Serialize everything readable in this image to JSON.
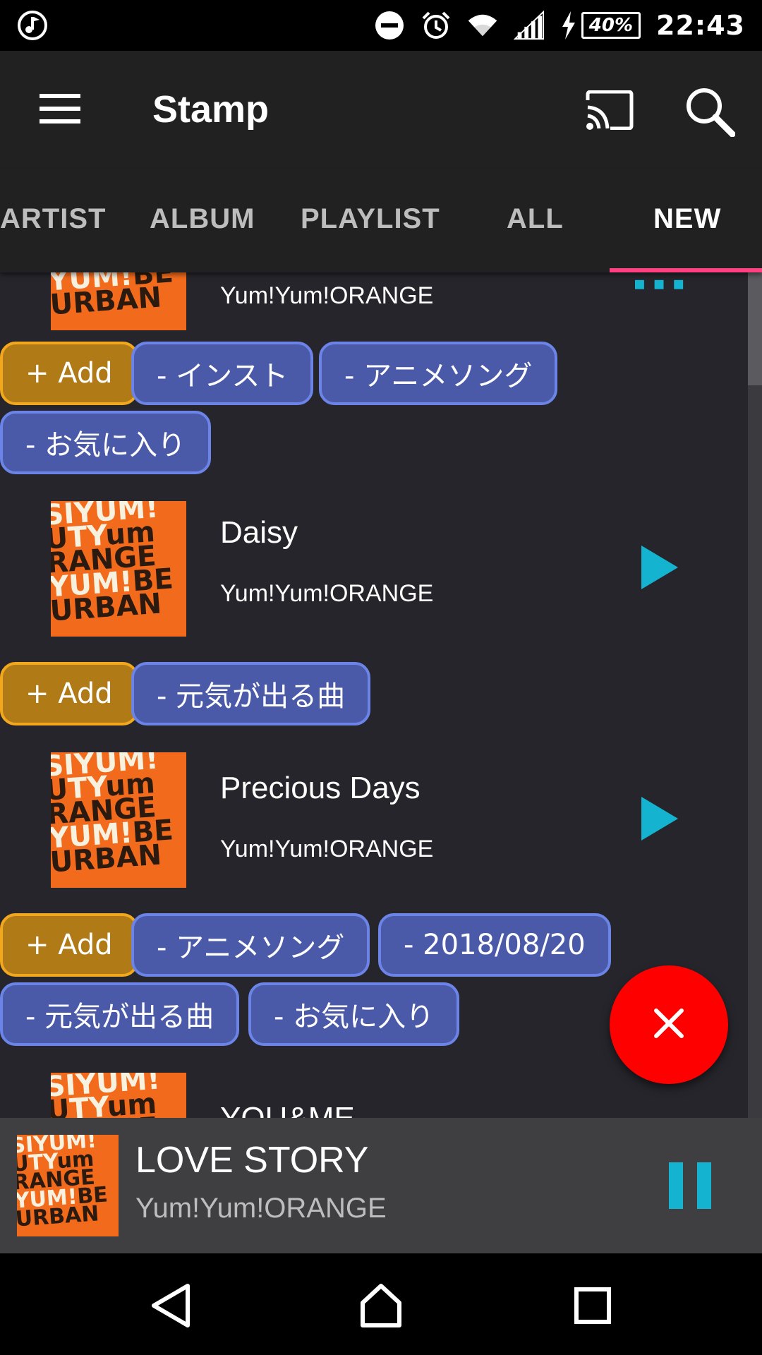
{
  "status_bar": {
    "battery": "40%",
    "time": "22:43"
  },
  "app_bar": {
    "title": "Stamp"
  },
  "tabs": [
    {
      "label": "ARTIST"
    },
    {
      "label": "ALBUM"
    },
    {
      "label": "PLAYLIST"
    },
    {
      "label": "ALL"
    },
    {
      "label": "NEW",
      "active": true
    }
  ],
  "list": {
    "partial_top": {
      "artist": "Yum!Yum!ORANGE",
      "chips": [
        "+ Add",
        "- インスト",
        "- アニメソング",
        "- お気に入り"
      ]
    },
    "songs": [
      {
        "title": "Daisy",
        "artist": "Yum!Yum!ORANGE",
        "chips": [
          "+ Add",
          "- 元気が出る曲"
        ]
      },
      {
        "title": "Precious Days",
        "artist": "Yum!Yum!ORANGE",
        "chips": [
          "+ Add",
          "- アニメソング",
          "- 2018/08/20",
          "- 元気が出る曲",
          "- お気に入り"
        ]
      }
    ],
    "partial_bottom": {
      "title": "YOU&ME"
    }
  },
  "now_playing": {
    "title": "LOVE STORY",
    "artist": "Yum!Yum!ORANGE"
  },
  "colors": {
    "background": "#25252b",
    "accent_pink": "#ff4081",
    "play_cyan": "#14b4d0",
    "fab_red": "#ff0000",
    "add_chip": "#b07a16",
    "tag_chip": "#4a5aa8"
  },
  "icons": {
    "status_left": "music-note-icon",
    "status_right": [
      "do-not-disturb-icon",
      "alarm-icon",
      "wifi-icon",
      "signal-icon",
      "charging-icon"
    ],
    "app_bar": [
      "menu-icon",
      "cast-icon",
      "search-icon"
    ],
    "fab": "close-icon",
    "navigation": [
      "back-icon",
      "home-icon",
      "recents-icon"
    ]
  }
}
